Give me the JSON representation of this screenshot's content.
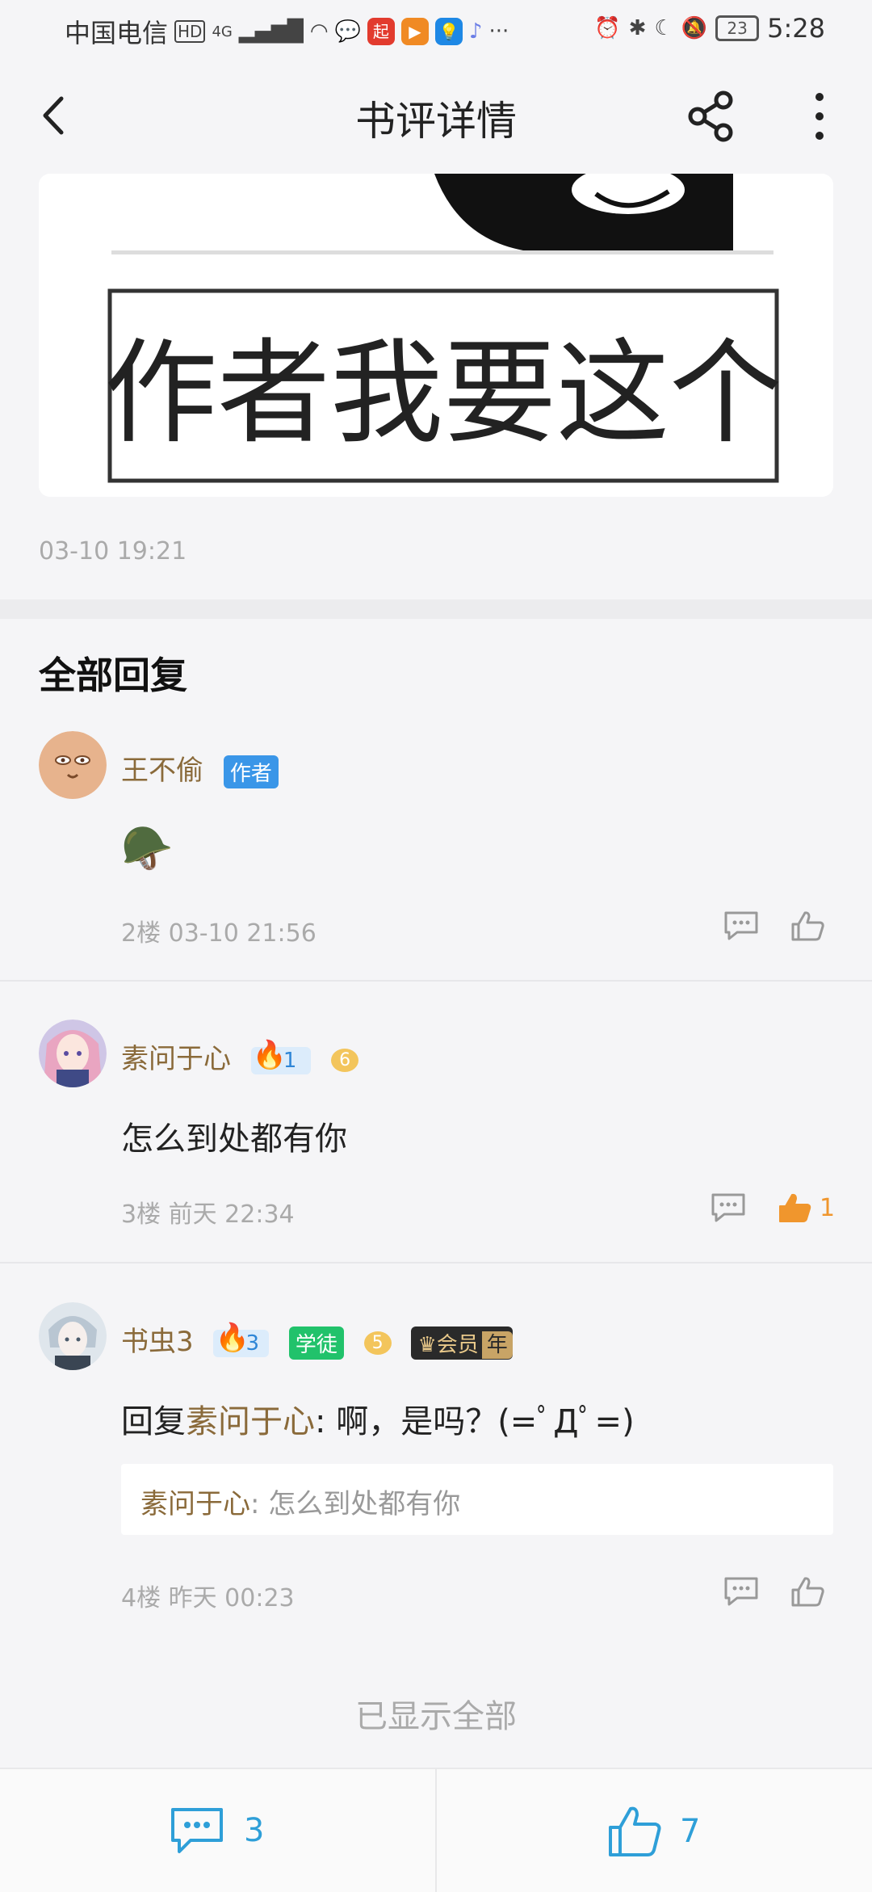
{
  "status_bar": {
    "carrier": "中国电信",
    "network": "4G",
    "battery": "23",
    "time": "5:28"
  },
  "header": {
    "title": "书评详情",
    "back_icon": "chevron-left-icon",
    "share_icon": "share-icon",
    "more_icon": "more-vertical-icon"
  },
  "post": {
    "meme_caption": "作者我要这个",
    "time": "03-10 19:21"
  },
  "replies_section": {
    "title": "全部回复"
  },
  "comments": [
    {
      "username": "王不偷",
      "badge": "作者",
      "content_emoji": "🪖",
      "floor_meta": "2楼 03-10 21:56",
      "likes": ""
    },
    {
      "username": "素问于心",
      "fan_level": "1",
      "medal_level": "6",
      "content": "怎么到处都有你",
      "floor_meta": "3楼 前天 22:34",
      "likes": "1"
    },
    {
      "username": "书虫3",
      "fan_level": "3",
      "title_badge": "学徒",
      "medal_level": "5",
      "vip_badge": "会员",
      "vip_tag": "年",
      "reply_prefix": "回复",
      "reply_to": "素问于心",
      "reply_text": ": 啊，是吗？(=ﾟДﾟ=)",
      "quote_user": "素问于心",
      "quote_text": ": 怎么到处都有你",
      "floor_meta": "4楼 昨天 00:23",
      "likes": ""
    }
  ],
  "footer_note": "已显示全部",
  "bottom_bar": {
    "comment_count": "3",
    "like_count": "7"
  },
  "colors": {
    "accent_blue": "#2e9fd8",
    "username_brown": "#8a6a3a",
    "like_orange": "#f0962d"
  }
}
